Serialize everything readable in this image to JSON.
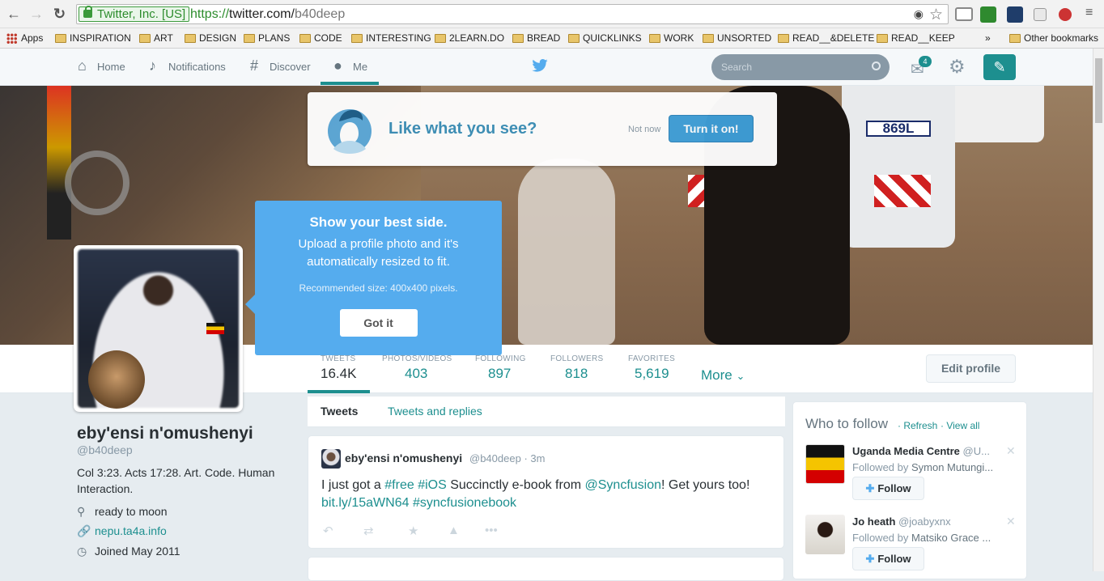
{
  "browser": {
    "nav_back": "←",
    "nav_forward": "→",
    "nav_reload": "↻",
    "ev_cert": "Twitter, Inc. [US]",
    "url_scheme": "https://",
    "url_host": "twitter.com/",
    "url_path": "b40deep",
    "bookmarks": [
      "Apps",
      "INSPIRATION",
      "ART",
      "DESIGN",
      "PLANS",
      "CODE",
      "INTERESTING",
      "2LEARN.DO",
      "BREAD",
      "QUICKLINKS",
      "WORK",
      "UNSORTED",
      "READ__&DELETE",
      "READ__KEEP"
    ],
    "bookmarks_overflow": "»",
    "other_bookmarks": "Other bookmarks"
  },
  "nav": {
    "home": "Home",
    "notifications": "Notifications",
    "discover": "Discover",
    "me": "Me",
    "search_placeholder": "Search",
    "dm_badge": "4"
  },
  "prompt": {
    "question": "Like what you see?",
    "not_now": "Not now",
    "turn_on": "Turn it on!"
  },
  "tooltip": {
    "title": "Show your best side.",
    "body": "Upload a profile photo and it's automatically resized to fit.",
    "recommended": "Recommended size: 400x400 pixels.",
    "got_it": "Got it"
  },
  "header_plate": "869L",
  "stats": [
    {
      "label": "TWEETS",
      "value": "16.4K"
    },
    {
      "label": "PHOTOS/VIDEOS",
      "value": "403"
    },
    {
      "label": "FOLLOWING",
      "value": "897"
    },
    {
      "label": "FOLLOWERS",
      "value": "818"
    },
    {
      "label": "FAVORITES",
      "value": "5,619"
    }
  ],
  "more": "More",
  "edit_profile": "Edit profile",
  "profile": {
    "name": "eby'ensi n'omushenyi",
    "handle": "@b40deep",
    "bio": "Col 3:23. Acts 17:28. Art. Code. Human Interaction.",
    "location": "ready to moon",
    "website": "nepu.ta4a.info",
    "joined": "Joined May 2011"
  },
  "tabs": {
    "tweets": "Tweets",
    "tweets_replies": "Tweets and replies"
  },
  "tweet": {
    "name": "eby'ensi n'omushenyi",
    "handle": "@b40deep",
    "time": "· 3m",
    "t1": "I just got a ",
    "h1": "#free",
    "t2": " ",
    "h2": "#iOS",
    "t3": " Succinctly e-book from ",
    "m1": "@Syncfusion",
    "t4": "! Get yours too!",
    "link": "bit.ly/15aWN64",
    "t5": " ",
    "h3": "#syncfusionebook"
  },
  "who_to_follow": {
    "title": "Who to follow",
    "refresh": "· Refresh",
    "view_all": "· View all",
    "users": [
      {
        "name": "Uganda Media Centre",
        "handle": "@U...",
        "followed_by_prefix": "Followed by ",
        "followed_by": "Symon Mutungi...",
        "follow": "Follow"
      },
      {
        "name": "Jo heath",
        "handle": "@joabyxnx",
        "followed_by_prefix": "Followed by ",
        "followed_by": "Matsiko Grace ...",
        "follow": "Follow"
      }
    ]
  },
  "colors": {
    "accent": "#1d8f8f",
    "tooltip": "#55acee",
    "button": "#3f9fd8"
  }
}
